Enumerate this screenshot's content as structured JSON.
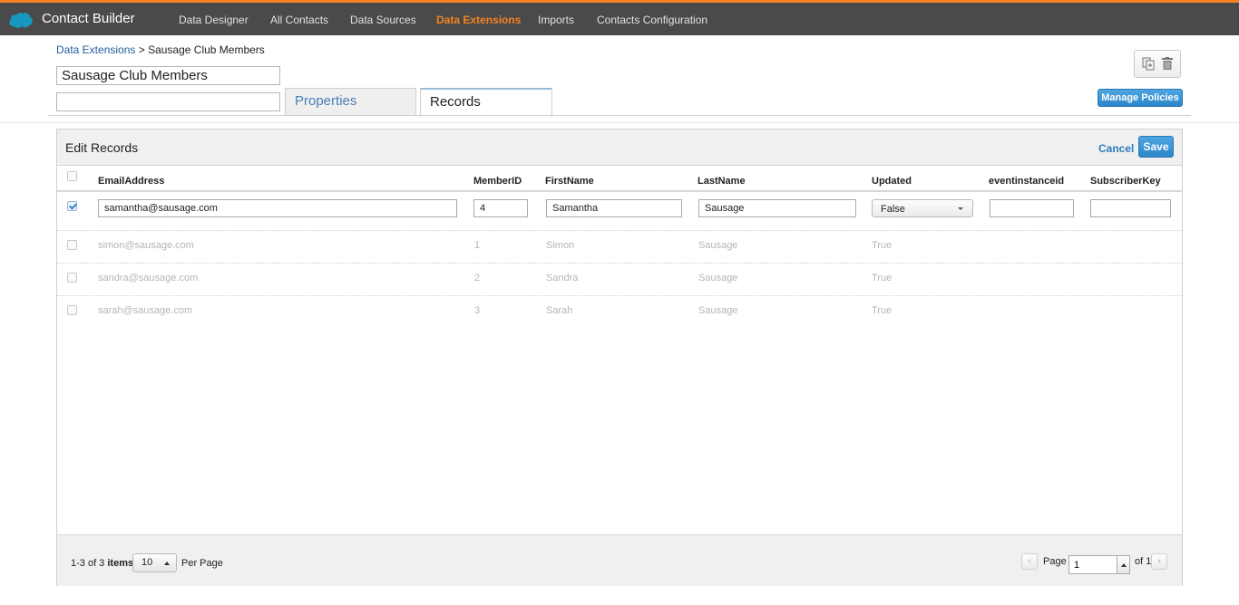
{
  "app": {
    "title": "Contact Builder",
    "brand_color": "#f58220"
  },
  "nav": {
    "items": [
      {
        "label": "Data Designer"
      },
      {
        "label": "All Contacts"
      },
      {
        "label": "Data Sources"
      },
      {
        "label": "Data Extensions",
        "active": true
      },
      {
        "label": "Imports"
      },
      {
        "label": "Contacts Configuration"
      }
    ]
  },
  "breadcrumb": {
    "link": "Data Extensions",
    "separator": " > ",
    "current": "Sausage Club Members"
  },
  "extension": {
    "name": "Sausage Club Members",
    "description": ""
  },
  "tabs": {
    "properties": "Properties",
    "records": "Records"
  },
  "toolbar": {
    "copy_icon": "copy-icon",
    "delete_icon": "trash-icon",
    "manage_policies": "Manage Policies"
  },
  "editor": {
    "title": "Edit Records",
    "cancel": "Cancel",
    "save": "Save",
    "columns": [
      "EmailAddress",
      "MemberID",
      "FirstName",
      "LastName",
      "Updated",
      "eventinstanceid",
      "SubscriberKey"
    ],
    "edit_row": {
      "checked": true,
      "email": "samantha@sausage.com",
      "member_id": "4",
      "first_name": "Samantha",
      "last_name": "Sausage",
      "updated": "False",
      "eventinstanceid": "",
      "subscriber_key": ""
    },
    "rows": [
      {
        "email": "simon@sausage.com",
        "member_id": "1",
        "first_name": "Simon",
        "last_name": "Sausage",
        "updated": "True"
      },
      {
        "email": "sandra@sausage.com",
        "member_id": "2",
        "first_name": "Sandra",
        "last_name": "Sausage",
        "updated": "True"
      },
      {
        "email": "sarah@sausage.com",
        "member_id": "3",
        "first_name": "Sarah",
        "last_name": "Sausage",
        "updated": "True"
      }
    ]
  },
  "pagination": {
    "range": "1-3 of 3",
    "items_label": "items",
    "per_page_value": "10",
    "per_page_label": "Per Page",
    "page_label": "Page",
    "page_value": "1",
    "of_label": "of 1"
  }
}
